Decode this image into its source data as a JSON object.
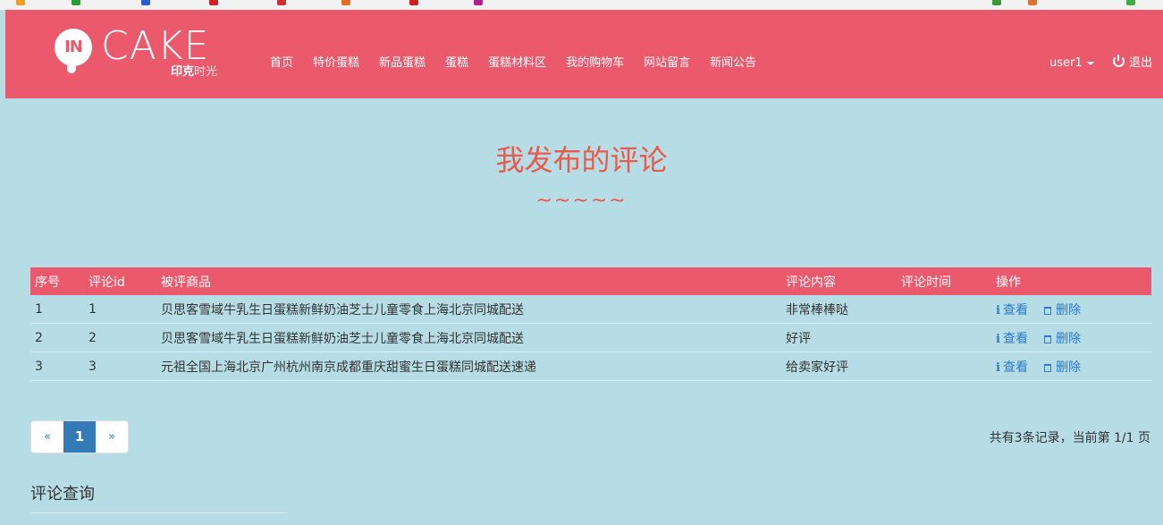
{
  "brand": {
    "logo_in": "IN",
    "logo_cake": "CAKE",
    "logo_sub_bold": "印克",
    "logo_sub_rest": "时光"
  },
  "nav": {
    "items": [
      {
        "label": "首页"
      },
      {
        "label": "特价蛋糕"
      },
      {
        "label": "新品蛋糕"
      },
      {
        "label": "蛋糕"
      },
      {
        "label": "蛋糕材料区"
      },
      {
        "label": "我的购物车"
      },
      {
        "label": "网站留言"
      },
      {
        "label": "新闻公告"
      }
    ],
    "user": "user1",
    "logout": "退出"
  },
  "page": {
    "title": "我发布的评论",
    "decoration": "~~~~~"
  },
  "table": {
    "headers": [
      "序号",
      "评论id",
      "被评商品",
      "评论内容",
      "评论时间",
      "操作"
    ],
    "rows": [
      {
        "index": "1",
        "id": "1",
        "product": "贝思客雪域牛乳生日蛋糕新鲜奶油芝士儿童零食上海北京同城配送",
        "content": "非常棒棒哒",
        "time": ""
      },
      {
        "index": "2",
        "id": "2",
        "product": "贝思客雪域牛乳生日蛋糕新鲜奶油芝士儿童零食上海北京同城配送",
        "content": "好评",
        "time": ""
      },
      {
        "index": "3",
        "id": "3",
        "product": "元祖全国上海北京广州杭州南京成都重庆甜蜜生日蛋糕同城配送速递",
        "content": "给卖家好评",
        "time": ""
      }
    ],
    "view_label": "查看",
    "delete_label": "删除"
  },
  "pagination": {
    "prev": "«",
    "current": "1",
    "next": "»",
    "summary": "共有3条记录，当前第 1/1 页"
  },
  "search": {
    "title": "评论查询"
  },
  "colors": {
    "brand": "#ea5a6c",
    "page_bg": "#b6dde5",
    "title": "#ea5a4a",
    "link": "#2a7ad0"
  }
}
